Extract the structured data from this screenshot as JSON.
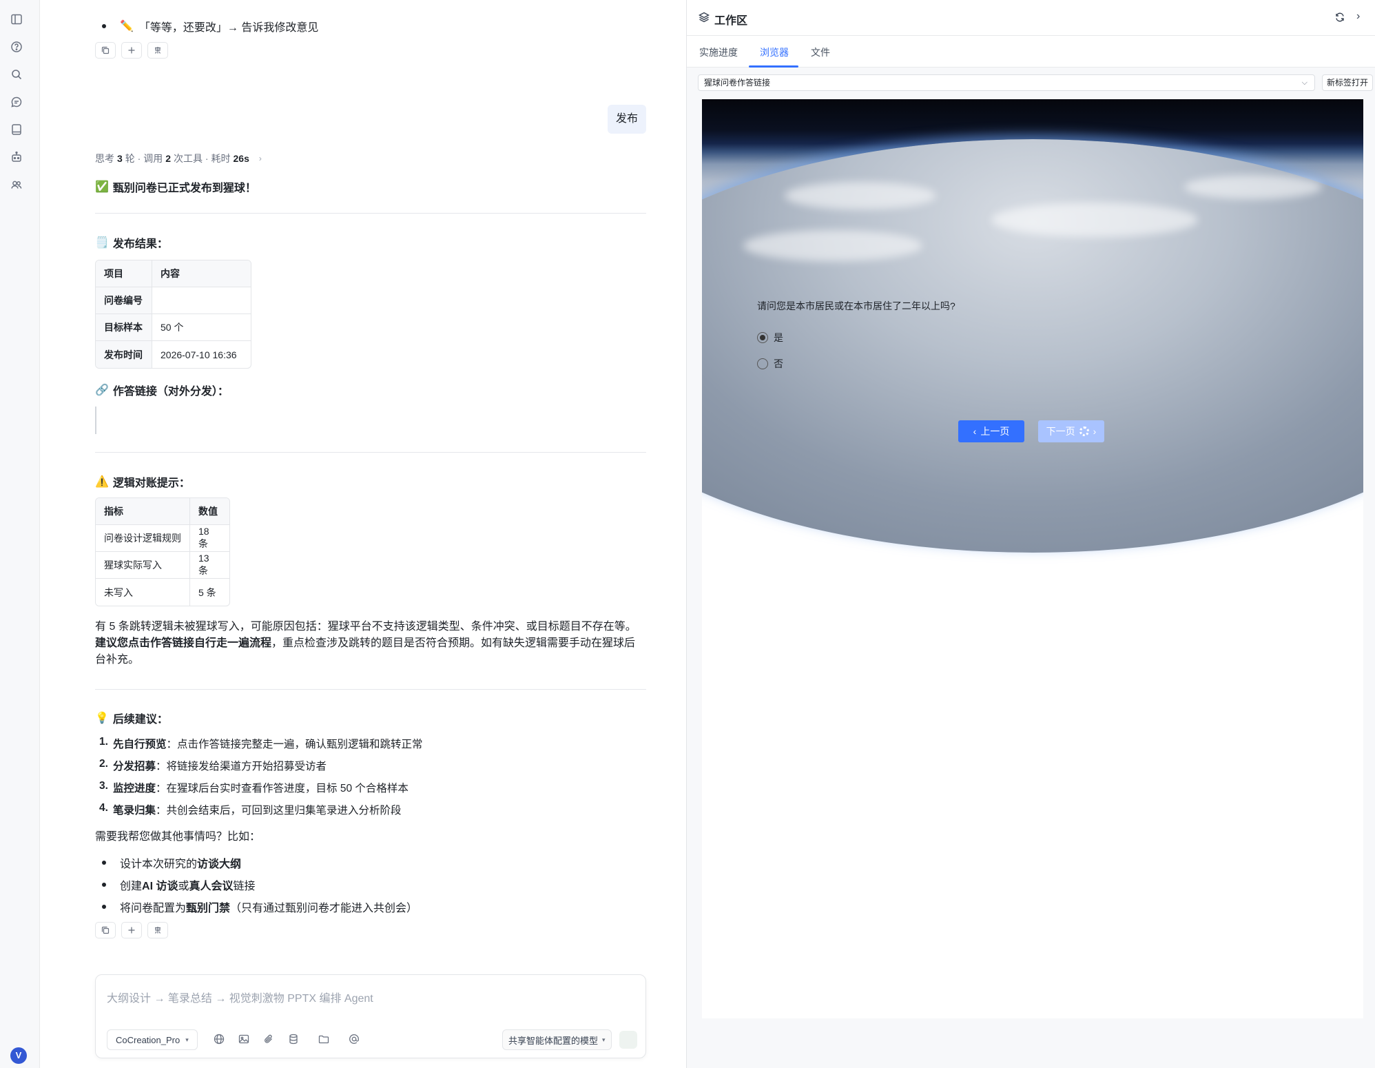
{
  "chat": {
    "top_bullet": "「等等，还要改」→ 告诉我修改意见",
    "user_message": "发布",
    "meta": {
      "p1": "思考",
      "rounds": "3",
      "p2": "轮 · 调用",
      "tools": "2",
      "p3": "次工具 · 耗时",
      "time": "26s"
    },
    "success": "甄别问卷已正式发布到猩球！",
    "publish_heading": "发布结果：",
    "publish_table": {
      "headers": [
        "项目",
        "内容"
      ],
      "rows": [
        [
          "问卷编号",
          ""
        ],
        [
          "目标样本",
          "50 个"
        ],
        [
          "发布时间",
          "2026-07-10 16:36"
        ]
      ]
    },
    "link_heading": "作答链接（对外分发）：",
    "logic_heading": "逻辑对账提示：",
    "logic_table": {
      "headers": [
        "指标",
        "数值"
      ],
      "rows": [
        [
          "问卷设计逻辑规则",
          "18 条"
        ],
        [
          "猩球实际写入",
          "13 条"
        ],
        [
          "未写入",
          "5 条"
        ]
      ]
    },
    "para_1": "有 5 条跳转逻辑未被猩球写入，可能原因包括：猩球平台不支持该逻辑类型、条件冲突、或目标题目不存在等。",
    "para_bold": "建议您点击作答链接自行走一遍流程",
    "para_2": "，重点检查涉及跳转的题目是否符合预期。如有缺失逻辑需要手动在猩球后台补充。",
    "next_heading": "后续建议：",
    "next_steps": [
      {
        "n": "1.",
        "b": "先自行预览",
        "t": "：点击作答链接完整走一遍，确认甄别逻辑和跳转正常"
      },
      {
        "n": "2.",
        "b": "分发招募",
        "t": "：将链接发给渠道方开始招募受访者"
      },
      {
        "n": "3.",
        "b": "监控进度",
        "t": "：在猩球后台实时查看作答进度，目标 50 个合格样本"
      },
      {
        "n": "4.",
        "b": "笔录归集",
        "t": "：共创会结束后，可回到这里归集笔录进入分析阶段"
      }
    ],
    "ask": "需要我帮您做其他事情吗？比如：",
    "suggestions": [
      {
        "a": "设计本次研究的",
        "b": "访谈大纲",
        "c": "",
        "d": "",
        "e": ""
      },
      {
        "a": "创建",
        "b": "AI 访谈",
        "c": "或",
        "d": "真人会议",
        "e": "链接"
      },
      {
        "a": "将问卷配置为",
        "b": "甄别门禁",
        "c": "（只有通过甄别问卷才能进入共创会）",
        "d": "",
        "e": ""
      }
    ],
    "composer": {
      "placeholder": "大纲设计 → 笔录总结 → 视觉刺激物 PPTX 编排 Agent",
      "model": "CoCreation_Pro",
      "right_model": "共享智能体配置的模型"
    }
  },
  "workspace": {
    "title": "工作区",
    "tabs": [
      "实施进度",
      "浏览器",
      "文件"
    ],
    "active_tab": "浏览器",
    "url": "猩球问卷作答链接",
    "new_tab": "新标签打开",
    "question": "请问您是本市居民或在本市居住了二年以上吗?",
    "options": [
      {
        "label": "是",
        "selected": true
      },
      {
        "label": "否",
        "selected": false
      }
    ],
    "prev": "上一页",
    "next": "下一页"
  },
  "user": {
    "initial": "V"
  },
  "colors": {
    "accent": "#3370ff",
    "bubble": "#edf2fc",
    "avatar": "#3358d4"
  },
  "icons": [
    "sidebar-toggle-icon",
    "help-icon",
    "search-icon",
    "chat-icon",
    "book-icon",
    "robot-icon",
    "users-icon",
    "copy-icon",
    "plus-icon",
    "feedback-icon",
    "globe-icon",
    "image-icon",
    "paperclip-icon",
    "database-icon",
    "folder-icon",
    "at-icon",
    "layers-icon",
    "refresh-icon"
  ]
}
